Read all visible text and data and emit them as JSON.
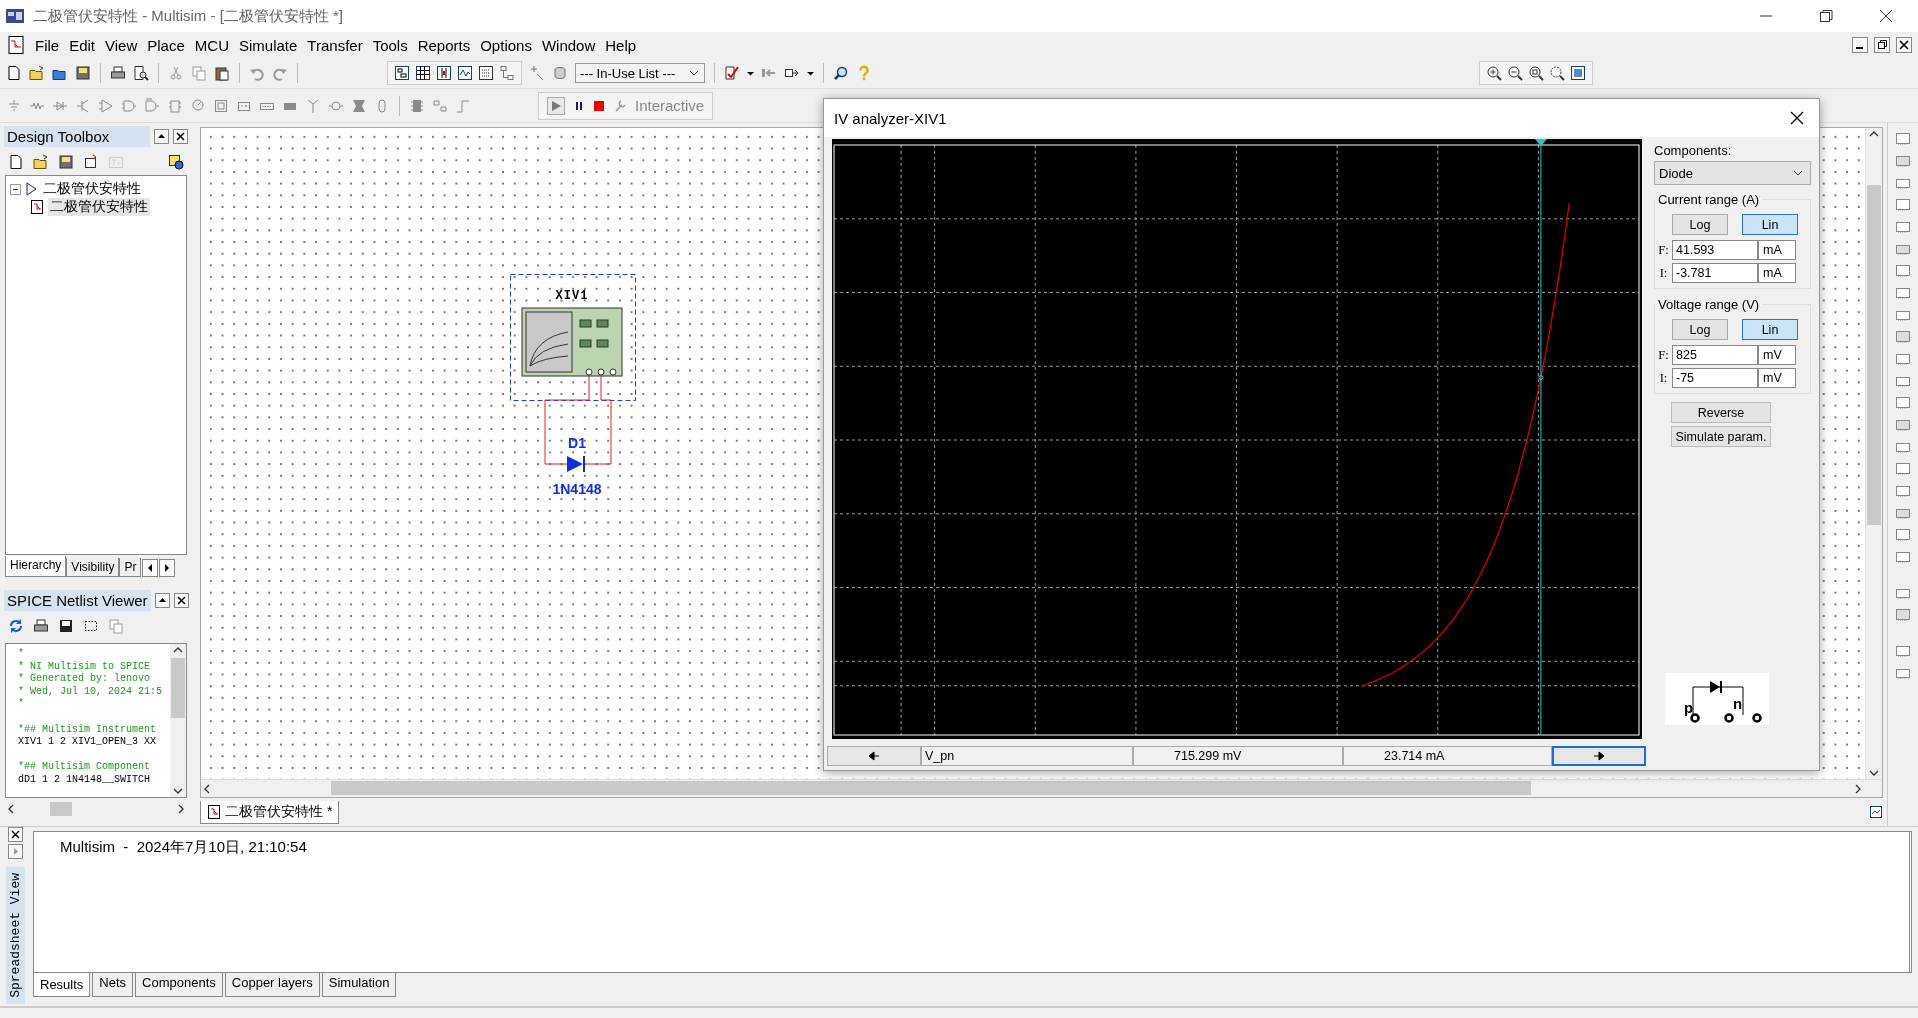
{
  "title_bar": {
    "title": "二极管伏安特性 - Multisim - [二极管伏安特性 *]"
  },
  "menu_bar": {
    "items": [
      "File",
      "Edit",
      "View",
      "Place",
      "MCU",
      "Simulate",
      "Transfer",
      "Tools",
      "Reports",
      "Options",
      "Window",
      "Help"
    ]
  },
  "toolbar": {
    "list_dropdown": "--- In-Use List ---"
  },
  "simulation_toolbar": {
    "mode": "Interactive"
  },
  "design_toolbox": {
    "title": "Design Toolbox",
    "tree": [
      {
        "label": "二极管伏安特性",
        "expanded": true,
        "children": [
          {
            "label": "二极管伏安特性",
            "selected": true
          }
        ]
      }
    ],
    "tabs": [
      {
        "label": "Hierarchy",
        "selected": true
      },
      {
        "label": "Visibility",
        "selected": false
      },
      {
        "label": "Pr",
        "selected": false
      }
    ]
  },
  "netlist_viewer": {
    "title": "SPICE Netlist Viewer",
    "lines": [
      {
        "kind": "comment",
        "text": "*"
      },
      {
        "kind": "comment",
        "text": "* NI Multisim to SPICE"
      },
      {
        "kind": "comment",
        "text": "* Generated by: lenovo"
      },
      {
        "kind": "comment",
        "text": "* Wed, Jul 10, 2024 21:5"
      },
      {
        "kind": "comment",
        "text": "*"
      },
      {
        "kind": "section",
        "text": "*## Multisim Instrument"
      },
      {
        "kind": "code",
        "text": "XIV1 1 2 XIV1_OPEN_3 XX"
      },
      {
        "kind": "section",
        "text": "*## Multisim Component"
      },
      {
        "kind": "code",
        "text": "dD1 1 2 1N4148__SWITCH"
      }
    ]
  },
  "schematic": {
    "instrument": {
      "label": "XIV1",
      "selected": true
    },
    "component": {
      "reference": "D1",
      "value": "1N4148"
    }
  },
  "document_tabs": [
    {
      "label": "二极管伏安特性 *",
      "selected": true
    }
  ],
  "iv_analyzer": {
    "title": "IV analyzer-XIV1",
    "components_label": "Components:",
    "component": "Diode",
    "current_range": {
      "title": "Current range (A)",
      "scales": [
        {
          "label": "Log",
          "selected": false
        },
        {
          "label": "Lin",
          "selected": true
        }
      ],
      "final": {
        "label": "F:",
        "value": "41.593",
        "unit": "mA"
      },
      "initial": {
        "label": "I:",
        "value": "-3.781",
        "unit": "mA"
      }
    },
    "voltage_range": {
      "title": "Voltage range (V)",
      "scales": [
        {
          "label": "Log",
          "selected": false
        },
        {
          "label": "Lin",
          "selected": true
        }
      ],
      "final": {
        "label": "F:",
        "value": "825",
        "unit": "mV"
      },
      "initial": {
        "label": "I:",
        "value": "-75",
        "unit": "mV"
      }
    },
    "buttons": [
      "Reverse",
      "Simulate param."
    ],
    "readout": {
      "name": "V_pn",
      "voltage": "715.299 mV",
      "current": "23.714 mA"
    },
    "terminal_labels": [
      "p",
      "n"
    ]
  },
  "spreadsheet": {
    "title": "Spreadsheet View",
    "message": "Multisim  -  2024年7月10日, 21:10:54",
    "tabs": [
      {
        "label": "Results",
        "selected": true
      },
      {
        "label": "Nets",
        "selected": false
      },
      {
        "label": "Components",
        "selected": false
      },
      {
        "label": "Copper layers",
        "selected": false
      },
      {
        "label": "Simulation",
        "selected": false
      }
    ]
  }
}
